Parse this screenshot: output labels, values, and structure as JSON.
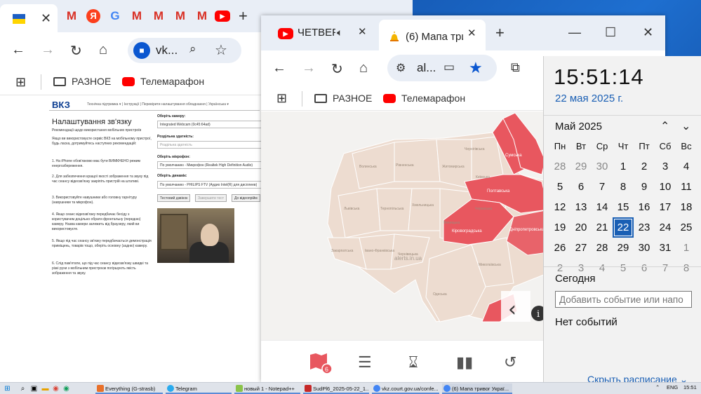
{
  "left_window": {
    "tab_close": "✕",
    "new_tab": "+",
    "address_text": "vk...",
    "bookmarks": [
      "РАЗНОЕ",
      "Телемарафон"
    ],
    "page": {
      "site_title": "ВКЗ",
      "nav_links": "Технічна підтримка ▾   |   Інструкції   |   Перевірити налаштування обладнання   |   Українська ▾",
      "heading": "Налаштування зв'язку",
      "intro": "Рекомендації щодо використання мобільних пристроїв",
      "intro2": "Якщо ви використовуєте сервіс ВКЗ на мобільному пристрої, будь ласка, дотримуйтесь наступних рекомендацій:",
      "recommendations": [
        "1. На iPhone обов'язково має бути ВИМКНЕНО режим енергозбереження.",
        "2. Для забезпечення кращої якості зображення та звуку під час сеансу відеозв'язку закріпіть пристрій на штативі.",
        "3. Використовуйте навушники або головну гарнітуру (навушники та мікрофон).",
        "4. Якщо сеанс відеозв'язку передбачає бесіду з користувачем доцільно обрати фронтальну (передню) камеру. Назва камери залежить від браузеру, який ви використовуєте.",
        "5. Якщо під час сеансу зв'язку передбачається демонстрація приміщень, товарів тощо, оберіть основну (задню) камеру.",
        "6. Слід пам'ятати, що під час сеансу відеозв'язку швидкі та різкі рухи з мобільним пристроєм погіршують якість зображення та звуку."
      ],
      "camera_label": "Оберіть камеру:",
      "camera_value": "Integrated Webcam (0c45:64ad)",
      "resolution_label": "Роздільна здатність:",
      "resolution_placeholder": "Роздільна здатність",
      "mic_label": "Оберіть мікрофон:",
      "mic_value": "По умолчанию - Микрофон (Realtek High Definition Audio)",
      "speaker_label": "Оберіть динамік:",
      "speaker_value": "По умолчанию - PHILIPS FTV (Аудио Intel(R) для дисплеев)",
      "btn_test_call": "Тестовий дзвінок",
      "btn_finish_test": "Завершити тест",
      "btn_to_video": "До відеопрійм"
    }
  },
  "mid_window": {
    "tabs": [
      {
        "title": "ЧЕТВЕРГ",
        "close": "✕"
      },
      {
        "title": "(6) Мапа три",
        "close": "✕"
      }
    ],
    "new_tab": "+",
    "address_text": "al...",
    "bookmarks": [
      "РАЗНОЕ",
      "Телемарафон"
    ],
    "map": {
      "regions_alert": [
        "Сумська",
        "Полтавська",
        "Кіровоградська",
        "Дніпропетровська"
      ],
      "regions_clear": [
        "Волинська",
        "Рівненська",
        "Житомирська",
        "Чернігівська",
        "Київська",
        "Львівська",
        "Тернопільська",
        "Хмельницька",
        "Вінницька",
        "Черкаська",
        "Закарпатська",
        "Івано-Франківська",
        "Чернівецька",
        "Миколаївська",
        "Одеська"
      ],
      "watermark": "alerts.in.ua",
      "badge_count": "6"
    }
  },
  "calendar": {
    "time": "15:51:14",
    "date": "22 мая 2025 г.",
    "month": "Май 2025",
    "weekdays": [
      "Пн",
      "Вт",
      "Ср",
      "Чт",
      "Пт",
      "Сб",
      "Вс"
    ],
    "weeks": [
      [
        "28",
        "29",
        "30",
        "1",
        "2",
        "3",
        "4"
      ],
      [
        "5",
        "6",
        "7",
        "8",
        "9",
        "10",
        "11"
      ],
      [
        "12",
        "13",
        "14",
        "15",
        "16",
        "17",
        "18"
      ],
      [
        "19",
        "20",
        "21",
        "22",
        "23",
        "24",
        "25"
      ],
      [
        "26",
        "27",
        "28",
        "29",
        "30",
        "31",
        "1"
      ],
      [
        "2",
        "3",
        "4",
        "5",
        "6",
        "7",
        "8"
      ]
    ],
    "today_day": "22",
    "today_label": "Сегодня",
    "event_placeholder": "Добавить событие или напо",
    "no_events": "Нет событий",
    "hide_schedule": "Скрыть расписание"
  },
  "taskbar": {
    "apps": [
      "Everything (G-strasb)",
      "Telegram",
      "новый 1 - Notepad++",
      "SudPl6_2025-05-22_1...",
      "vkz.court.gov.ua/confe...",
      "(6) Мапа тривог Украї..."
    ],
    "lang": "ENG",
    "clock": "15:51"
  },
  "colors": {
    "alert_red": "#e8575f",
    "clear_region": "#eddcd0",
    "accent_blue": "#1a5fb4"
  }
}
